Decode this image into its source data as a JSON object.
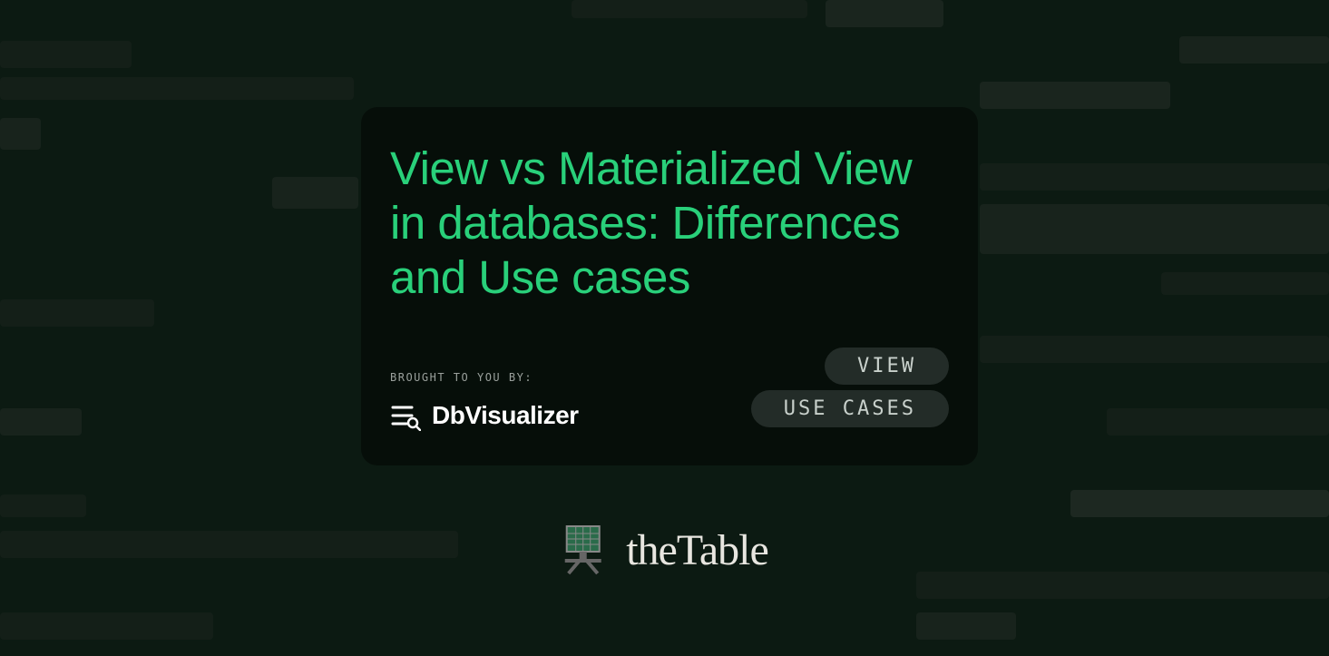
{
  "title": "View vs Materialized View in databases: Differences and Use cases",
  "brought_label": "BROUGHT TO YOU BY:",
  "sponsor": "DbVisualizer",
  "tags": [
    "VIEW",
    "USE CASES"
  ],
  "footer_brand": "theTable",
  "colors": {
    "accent": "#29d07a",
    "bg": "#0c1a12"
  }
}
